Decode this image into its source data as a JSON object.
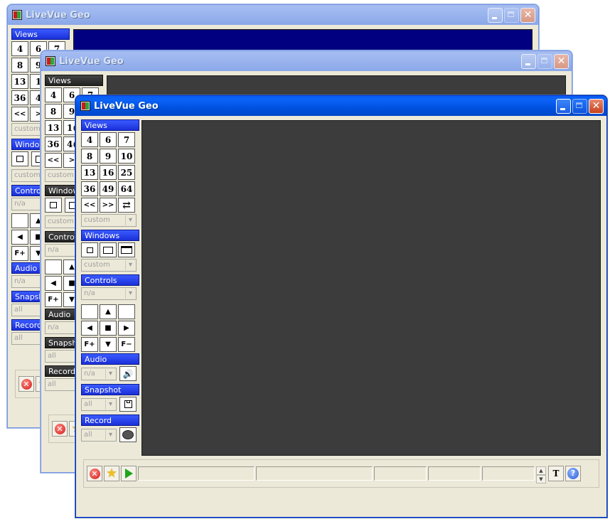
{
  "app": {
    "title": "LiveVue Geo"
  },
  "back_window": {
    "title": "LiveVue Geo",
    "views_header": "Views",
    "view_labels": [
      "4",
      "6",
      "7",
      "8",
      "9",
      "13",
      "1",
      "36",
      "4",
      "<<",
      ">"
    ],
    "custom": "custom",
    "windows_header": "Windo",
    "controls_header": "Controls",
    "na": "n/a",
    "audio_header": "Audio",
    "snapshot_header": "Snapsh",
    "record_header": "Record",
    "all": "all"
  },
  "mid_window": {
    "title": "LiveVue Geo",
    "views_header": "Views",
    "view_labels": [
      "4",
      "6",
      "7",
      "8",
      "9",
      "13",
      "1(",
      "36",
      "4(",
      "<<",
      ">"
    ],
    "custom": "custom",
    "windows_header": "Window",
    "controls_header": "Controls",
    "na": "n/a",
    "audio_header": "Audio",
    "snapshot_header": "Snapsh",
    "record_header": "Record",
    "all": "all"
  },
  "front_window": {
    "title": "LiveVue Geo",
    "views": {
      "header": "Views",
      "buttons": [
        "4",
        "6",
        "7",
        "8",
        "9",
        "10",
        "13",
        "16",
        "25",
        "36",
        "49",
        "64"
      ],
      "prev": "<<",
      "next": ">>",
      "swap_icon": "swap-arrows-icon",
      "custom_value": "custom"
    },
    "windows": {
      "header": "Windows",
      "custom_value": "custom"
    },
    "controls": {
      "header": "Controls",
      "preset_value": "n/a",
      "zoom_in": "F+",
      "zoom_out": "F−"
    },
    "audio": {
      "header": "Audio",
      "value": "n/a"
    },
    "snapshot": {
      "header": "Snapshot",
      "value": "all"
    },
    "record": {
      "header": "Record",
      "value": "all"
    },
    "statusbar": {
      "stop_icon": "stop-icon",
      "favorite_icon": "star-icon",
      "play_icon": "play-icon",
      "text_button": "T",
      "help_button": "?"
    }
  },
  "colors": {
    "titlebar_active": "#0052e0",
    "section_header": "#1a2fd8",
    "video_back": "#000080",
    "video_dark": "#3c3c3c",
    "window_bg": "#ece9d8"
  }
}
